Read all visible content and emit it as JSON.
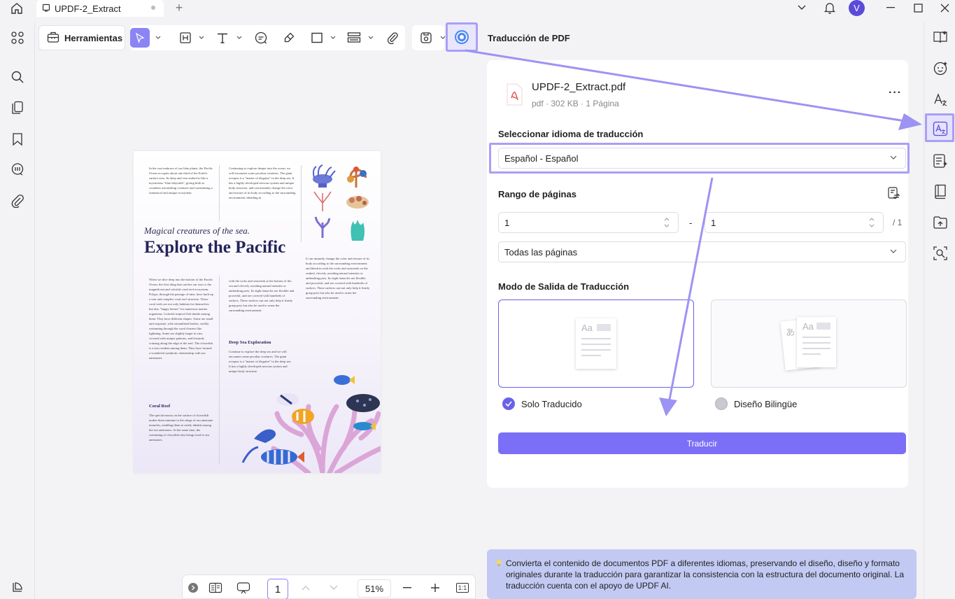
{
  "titlebar": {
    "tab_title": "UPDF-2_Extract",
    "avatar_letter": "V",
    "icons": [
      "home-icon",
      "file-tab-icon",
      "tab-close-dot",
      "add-tab-icon",
      "chevron-down-icon",
      "bell-icon",
      "minimize-icon",
      "maximize-icon",
      "close-icon"
    ]
  },
  "left_sidebar": {
    "icons": [
      "thumbnails-icon",
      "search-icon",
      "pages-icon",
      "bookmark-icon",
      "comment-icon",
      "attachment-icon",
      "layers-icon"
    ]
  },
  "toolbar": {
    "tools_label": "Herramientas",
    "icons": [
      "select-arrow-icon",
      "textbox-icon",
      "text-icon",
      "comment-icon",
      "highlighter-icon",
      "rectangle-icon",
      "stamp-icon",
      "attachment-icon",
      "save-icon",
      "updf-ai-icon"
    ]
  },
  "document": {
    "subtitle": "Magical creatures of the sea.",
    "title": "Explore the Pacific",
    "col1_top": "In the vast embrace of our blue planet, the Pacific Ocean occupies about one third of the Earth's surface area. Its deep and vast seabed is like a mysterious \"blue labyrinth\", giving birth to countless astonishing creatures and constituting a fantastical and unique ecosystem.",
    "col2_top": "Continuing to explore deeper into the ocean, we will encounter some peculiar creatures. The giant octopus is a \"master of disguise\" in the deep sea. It has a highly developed nervous system and unique body structure, and can instantly change the color and texture of its body according to the surrounding environment, blending in",
    "col1_mid": "When we dive deep into the bottom of the Pacific Ocean, the first thing that catches our eyes is the magnificent and colorful coral reef ecosystem. Polyps, through the passage of time, have built up a vast and complex coral reef structure. These coral reefs are not only habitats for themselves but also \"happy homes\" for numerous marine organisms. Colorful tropical fish shuttle among them. They have different shapes. Some are small and exquisite, with streamlined bodies, swiftly swimming through the coral clusters like lightning. Some are slightly larger in size, covered with unique patterns, and leisurely cruising along the edge of the reef. The clownfish is a star resident among them. They have formed a wonderful symbiotic relationship with sea anemones.",
    "col2_mid": "with the rocks and seaweeds at the bottom of the sea and cleverly avoiding natural enemies or ambushing prey. Its eight tentacles are flexible and powerful, and are covered with hundreds of suckers. These suckers can not only help it firmly grasp prey but also be used to sense the surrounding environment.",
    "col3_mid": "It can instantly change the color and texture of its body according to the surrounding environment and blend in with the rocks and seaweeds on the seabed, cleverly avoiding natural enemies or ambushing prey. Its eight tentacles are flexible and powerful, and are covered with hundreds of suckers. These suckers can not only help it firmly grasp prey but also be used to sense the surrounding environment.",
    "head_coral": "Coral Reef",
    "col1_bottom": "The special mucus on the surface of clownfish makes them immune to the stings of sea anemone tentacles, enabling them to safely inhabit among the sea anemones. At the same time, the swimming of clownfish also brings food to sea anemones.",
    "head_deep": "Deep Sea Exploration",
    "col2_bottom": "Continue to explore the deep sea and we will encounter some peculiar creatures. The giant octopus is a \"master of disguise\" in the deep sea. It has a highly developed nervous system and unique body structure."
  },
  "page_nav": {
    "current_page": "1",
    "zoom": "51%",
    "icons": [
      "collapse-arrow-icon",
      "page-layout-icon",
      "presentation-icon",
      "prev-page-icon",
      "next-page-icon",
      "zoom-out-icon",
      "zoom-in-icon",
      "actual-size-icon"
    ],
    "actual_size_label": "1:1"
  },
  "translate_panel": {
    "title": "Traducción de PDF",
    "file_name": "UPDF-2_Extract.pdf",
    "file_meta": "pdf · 302 KB · 1 Página",
    "lang_label": "Seleccionar idioma de traducción",
    "lang_value": "Español - Español",
    "range_label": "Rango de páginas",
    "range_from": "1",
    "range_sep": "-",
    "range_to": "1",
    "range_total": "/ 1",
    "pages_value": "Todas las páginas",
    "mode_label": "Modo de Salida de Traducción",
    "mode_only_translated": "Solo Traducido",
    "mode_bilingual": "Diseño Bilingüe",
    "mode_glyph_latin": "Aa",
    "mode_glyph_cjk": "あ",
    "translate_button": "Traducir",
    "info_text": "Convierta el contenido de documentos PDF a diferentes idiomas, preservando el diseño, diseño y formato originales durante la traducción para garantizar la consistencia con la estructura del documento original. La traducción cuenta con el apoyo de UPDF AI."
  },
  "right_sidebar": {
    "icons": [
      "read-mode-icon",
      "ai-chat-icon",
      "translate-text-icon",
      "pdf-translate-icon",
      "ai-summary-icon",
      "book-icon",
      "folder-upload-icon",
      "ocr-search-icon"
    ]
  },
  "colors": {
    "accent": "#7b6ff7",
    "highlight_border": "#a99ff6",
    "info_bg": "#c2c9f2",
    "title_navy": "#24245a"
  }
}
